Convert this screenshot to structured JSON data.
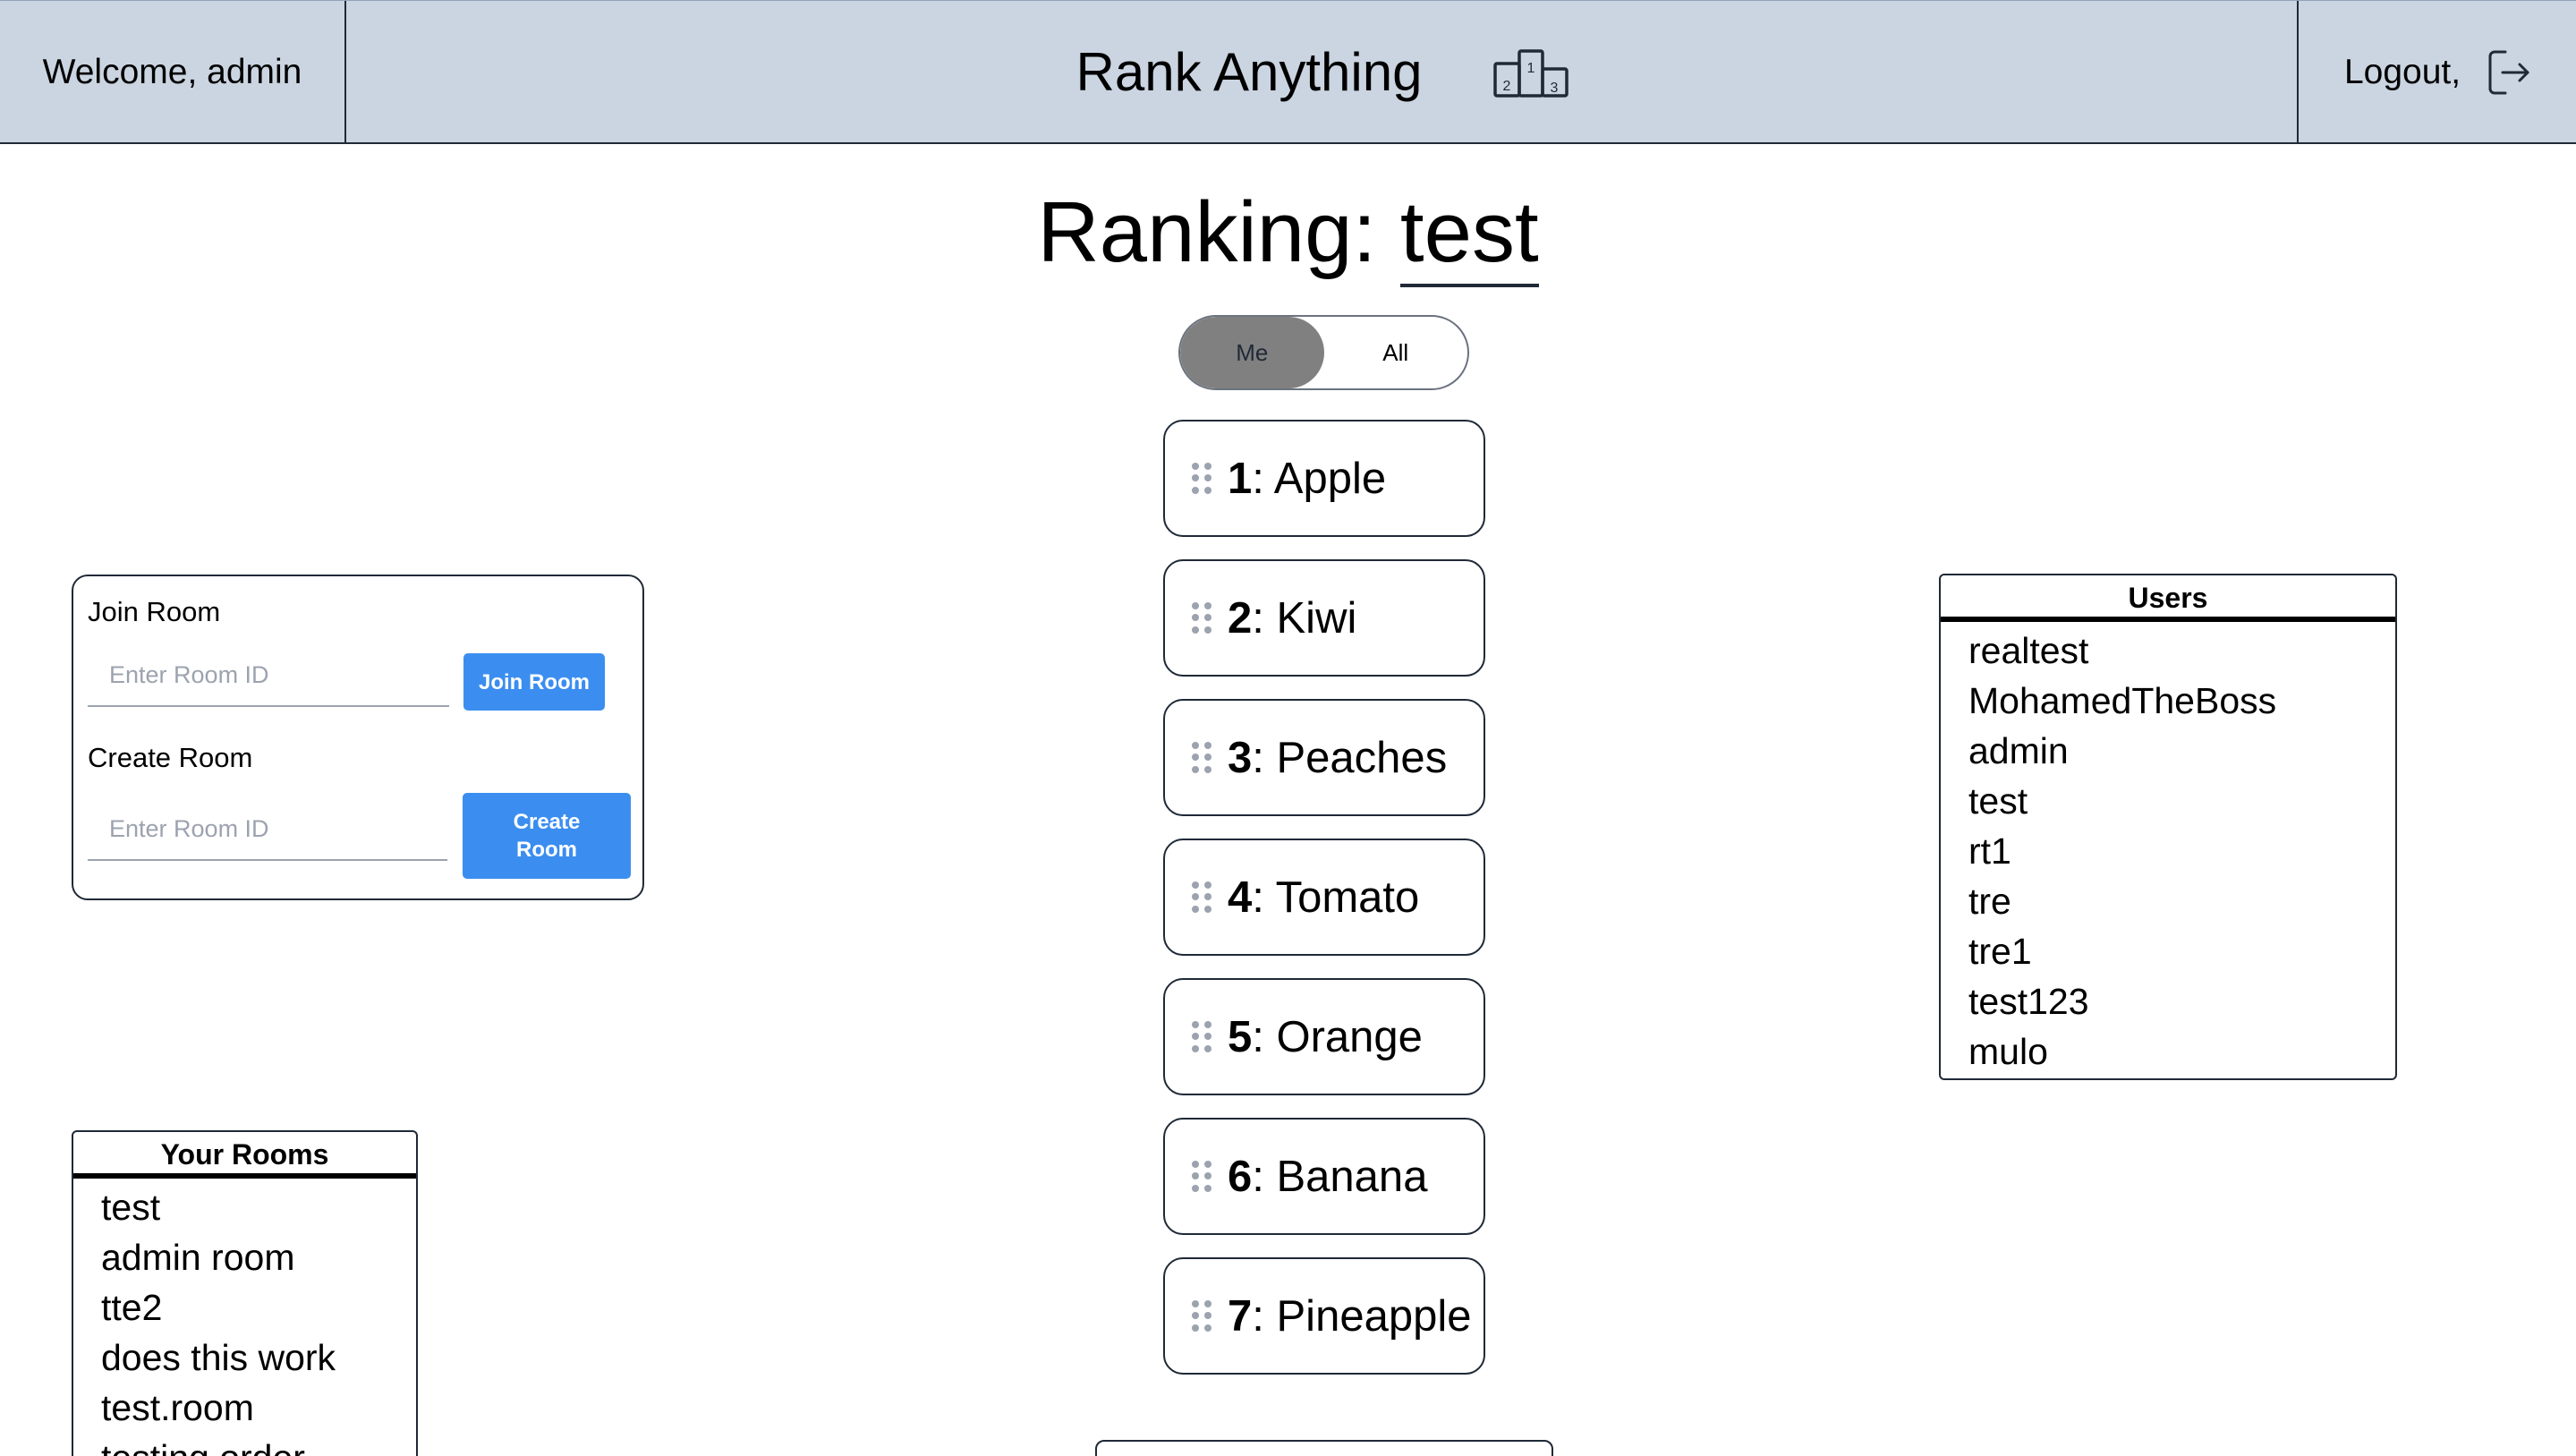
{
  "header": {
    "welcome": "Welcome, admin",
    "app_title": "Rank Anything",
    "logout_label": "Logout,",
    "podium_icon": "podium-icon",
    "logout_icon": "logout-icon"
  },
  "ranking": {
    "prefix": "Ranking: ",
    "room_name": "test"
  },
  "toggle": {
    "options": [
      "Me",
      "All"
    ],
    "selected": "Me"
  },
  "items": [
    {
      "rank": "1",
      "name": "Apple"
    },
    {
      "rank": "2",
      "name": "Kiwi"
    },
    {
      "rank": "3",
      "name": "Peaches"
    },
    {
      "rank": "4",
      "name": "Tomato"
    },
    {
      "rank": "5",
      "name": "Orange"
    },
    {
      "rank": "6",
      "name": "Banana"
    },
    {
      "rank": "7",
      "name": "Pineapple"
    }
  ],
  "room_panel": {
    "join_label": "Join Room",
    "join_placeholder": "Enter Room ID",
    "join_button": "Join Room",
    "create_label": "Create Room",
    "create_placeholder": "Enter Room ID",
    "create_button": "Create Room"
  },
  "users": {
    "title": "Users",
    "list": [
      "realtest",
      "MohamedTheBoss",
      "admin",
      "test",
      "rt1",
      "tre",
      "tre1",
      "test123",
      "mulo"
    ]
  },
  "your_rooms": {
    "title": "Your Rooms",
    "list": [
      "test",
      "admin room",
      "tte2",
      "does this work",
      "test.room",
      "testing order"
    ]
  },
  "colors": {
    "header_bg": "#cbd5e1",
    "accent_blue": "#3b8ef0",
    "toggle_active": "#808080"
  }
}
